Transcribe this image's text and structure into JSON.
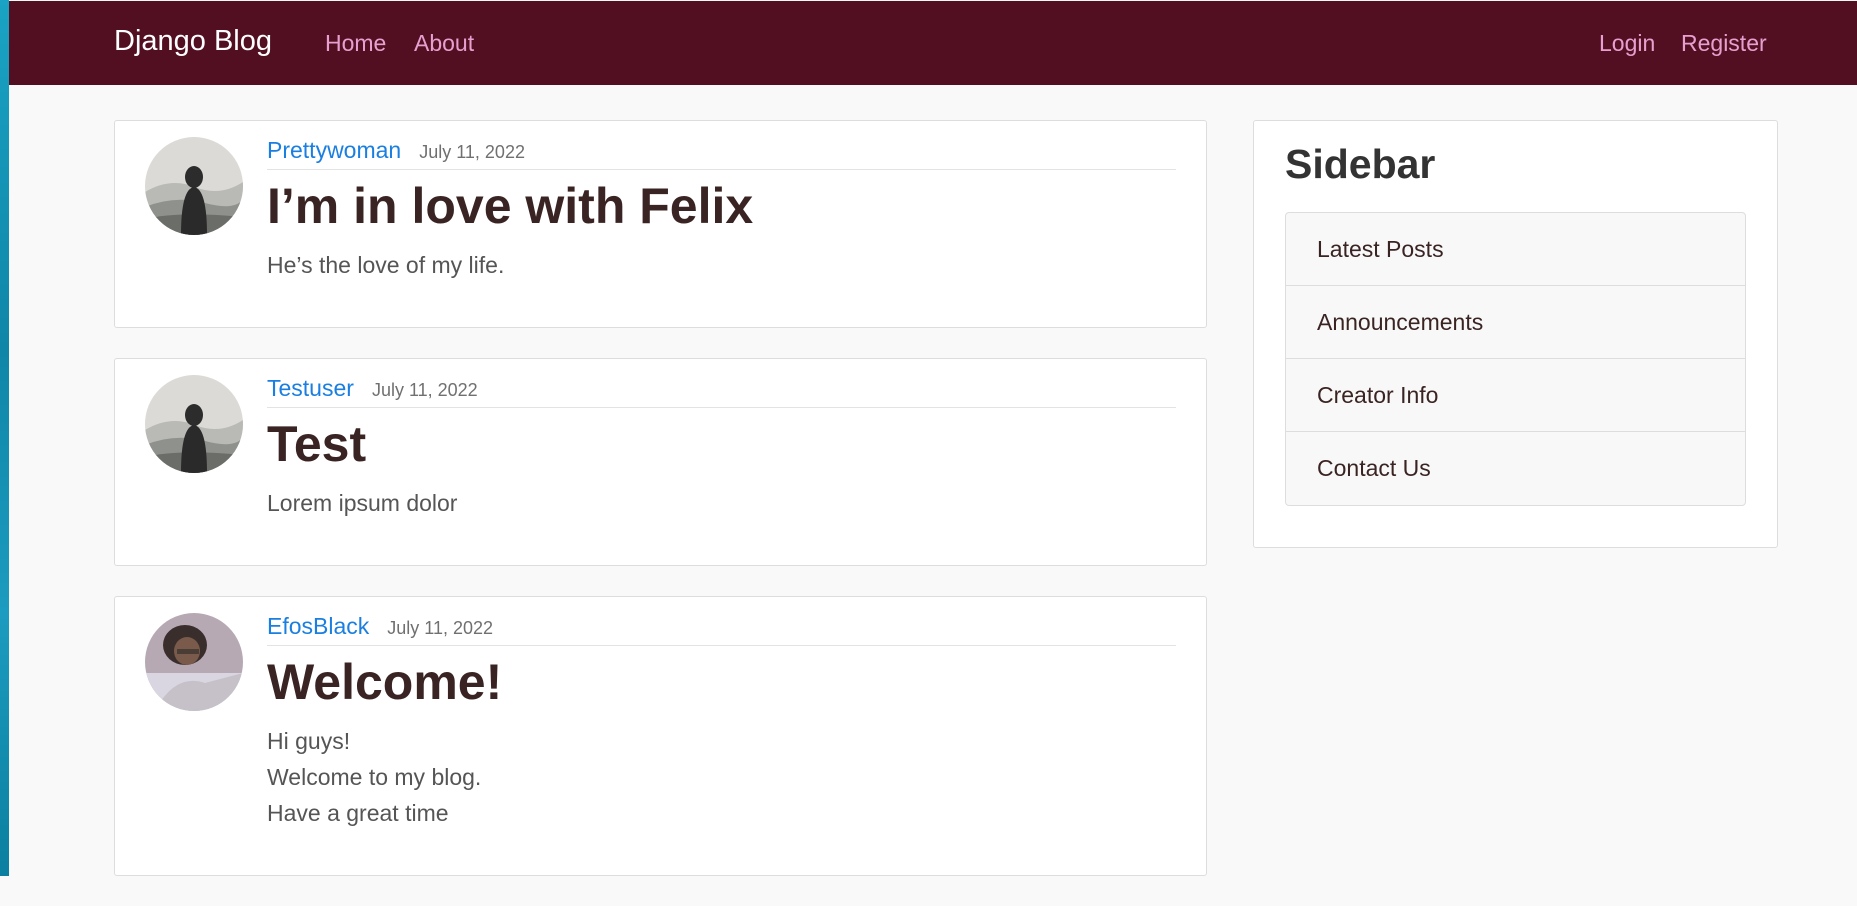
{
  "navbar": {
    "brand": "Django Blog",
    "links": [
      "Home",
      "About"
    ],
    "auth": [
      "Login",
      "Register"
    ]
  },
  "posts": [
    {
      "author": "Prettywoman",
      "date": "July 11, 2022",
      "title": "I’m in love with Felix",
      "lines": [
        "He’s the love of my life."
      ]
    },
    {
      "author": "Testuser",
      "date": "July 11, 2022",
      "title": "Test",
      "lines": [
        "Lorem ipsum dolor"
      ]
    },
    {
      "author": "EfosBlack",
      "date": "July 11, 2022",
      "title": "Welcome!",
      "lines": [
        "Hi guys!",
        "Welcome to my blog.",
        "Have a great time"
      ]
    }
  ],
  "sidebar": {
    "title": "Sidebar",
    "items": [
      "Latest Posts",
      "Announcements",
      "Creator Info",
      "Contact Us"
    ]
  },
  "colors": {
    "navbar_bg": "#530f22",
    "nav_link": "#e6a0cf",
    "author_link": "#1a7fe0",
    "title_text": "#3a2423"
  }
}
